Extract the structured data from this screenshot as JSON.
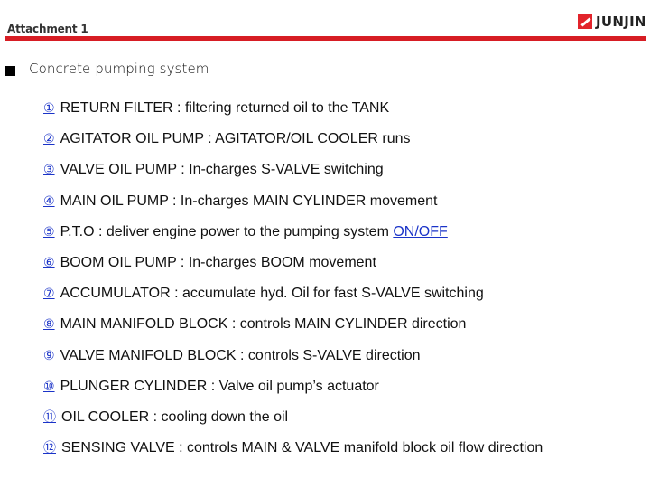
{
  "header": {
    "attachment_label": "Attachment 1",
    "brand": "JUNJIN",
    "accent_color": "#d71d24"
  },
  "section": {
    "title": "Concrete pumping system"
  },
  "items": [
    {
      "num": "①",
      "text": "RETURN FILTER : filtering returned oil to the TANK"
    },
    {
      "num": "②",
      "text": "AGITATOR OIL PUMP : AGITATOR/OIL COOLER runs"
    },
    {
      "num": "③",
      "text": "VALVE OIL PUMP : In-charges S-VALVE switching"
    },
    {
      "num": "④",
      "text": "MAIN OIL PUMP : In-charges  MAIN CYLINDER movement"
    },
    {
      "num": "⑤",
      "text": "P.T.O : deliver engine power to the pumping system ",
      "link": "ON/OFF"
    },
    {
      "num": "⑥",
      "text": "BOOM OIL PUMP : In-charges BOOM movement"
    },
    {
      "num": "⑦",
      "text": "ACCUMULATOR : accumulate hyd. Oil for fast S-VALVE switching"
    },
    {
      "num": "⑧",
      "text": "MAIN MANIFOLD BLOCK : controls MAIN CYLINDER direction"
    },
    {
      "num": "⑨",
      "text": "VALVE MANIFOLD BLOCK : controls S-VALVE direction"
    },
    {
      "num": "⑩",
      "text": "PLUNGER CYLINDER : Valve oil pump’s actuator"
    },
    {
      "num": "⑪",
      "text": "OIL COOLER : cooling down the oil"
    },
    {
      "num": "⑫",
      "text": "SENSING VALVE : controls MAIN & VALVE manifold block oil flow direction"
    }
  ]
}
